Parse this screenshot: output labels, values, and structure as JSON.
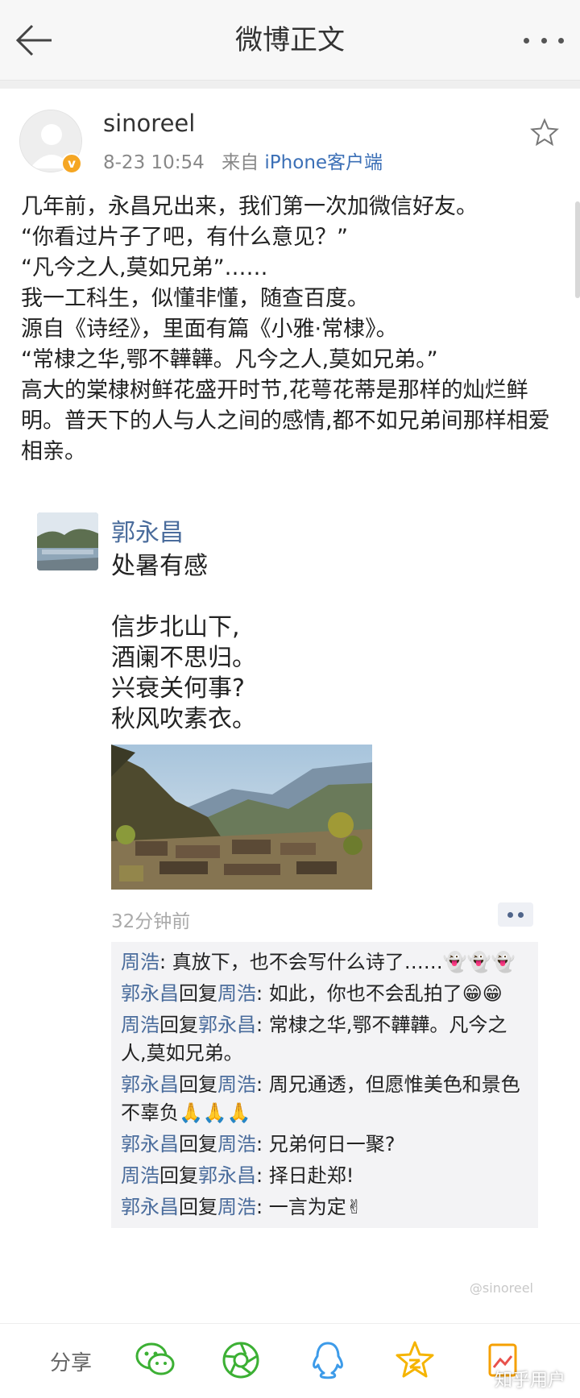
{
  "nav": {
    "title": "微博正文"
  },
  "post": {
    "username": "sinoreel",
    "time": "8-23 10:54",
    "source_prefix": "来自",
    "source": "iPhone客户端",
    "lines": [
      "几年前，永昌兄出来，我们第一次加微信好友。",
      "“你看过片子了吧，有什么意见？”",
      "“凡今之人,莫如兄弟”……",
      "我一工科生，似懂非懂，随查百度。",
      "源自《诗经》，里面有篇《小雅·常棣》。",
      "“常棣之华,鄂不韡韡。凡今之人,莫如兄弟。”",
      "高大的棠棣树鲜花盛开时节,花萼花蒂是那样的灿烂鲜明。普天下的人与人之间的感情,都不如兄弟间那样相爱相亲。"
    ]
  },
  "screenshot": {
    "name": "郭永昌",
    "lines": [
      "处暑有感",
      "",
      "信步北山下,",
      "酒阑不思归。",
      "兴衰关何事?",
      "秋风吹素衣。"
    ],
    "time": "32分钟前",
    "comments": [
      {
        "from": "周浩",
        "sep": "",
        "to": "",
        "text": ": 真放下，也不会写什么诗了……",
        "emoji": "👻👻👻"
      },
      {
        "from": "郭永昌",
        "sep": "回复",
        "to": "周浩",
        "text": ": 如此，你也不会乱拍了",
        "emoji": "😁😁"
      },
      {
        "from": "周浩",
        "sep": "回复",
        "to": "郭永昌",
        "text": ": 常棣之华,鄂不韡韡。凡今之人,莫如兄弟。",
        "emoji": ""
      },
      {
        "from": "郭永昌",
        "sep": "回复",
        "to": "周浩",
        "text": ": 周兄通透，但愿惟美色和景色不辜负",
        "emoji": "🙏🙏🙏"
      },
      {
        "from": "郭永昌",
        "sep": "回复",
        "to": "周浩",
        "text": ": 兄弟何日一聚?",
        "emoji": ""
      },
      {
        "from": "周浩",
        "sep": "回复",
        "to": "郭永昌",
        "text": ": 择日赴郑!",
        "emoji": ""
      },
      {
        "from": "郭永昌",
        "sep": "回复",
        "to": "周浩",
        "text": ": 一言为定",
        "emoji": "✌"
      }
    ],
    "watermark": "@sinoreel"
  },
  "bottombar": {
    "share_label": "分享",
    "icons": [
      "wechat-icon",
      "moments-icon",
      "qq-icon",
      "qzone-icon",
      "more-share-icon"
    ],
    "zhihu_watermark": "知乎用户"
  },
  "colors": {
    "link_blue": "#4a6c9c",
    "source_blue": "#3b6fb6",
    "wechat_green": "#3cb034",
    "qq_blue": "#3d9be9",
    "qzone_yellow": "#f5b400",
    "badge_orange": "#f5a623"
  }
}
